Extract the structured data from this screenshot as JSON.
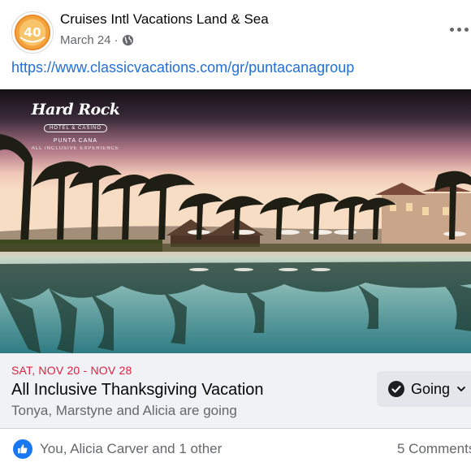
{
  "post": {
    "page_name": "Cruises Intl Vacations Land & Sea",
    "date": "March 24",
    "separator": "·",
    "link": "https://www.classicvacations.com/gr/puntacanagroup",
    "avatar_text": "40",
    "avatar_icon": "anniversary-logo",
    "privacy_icon": "globe-icon",
    "more_icon": "more-options-icon"
  },
  "photo": {
    "logo_brand": "Hard Rock",
    "logo_sub": "HOTEL & CASINO",
    "logo_location": "PUNTA CANA",
    "logo_tagline": "ALL INCLUSIVE EXPERIENCE"
  },
  "event": {
    "date_range": "SAT, NOV 20 - NOV 28",
    "title": "All Inclusive Thanksgiving Vacation",
    "attendees": "Tonya, Marstyne and Alicia are going",
    "going_label": "Going",
    "date_color": "#e41e3f"
  },
  "reactions": {
    "summary": "You, Alicia Carver and 1 other",
    "comments": "5 Comments",
    "like_icon": "like-icon",
    "accent": "#1877f2"
  }
}
